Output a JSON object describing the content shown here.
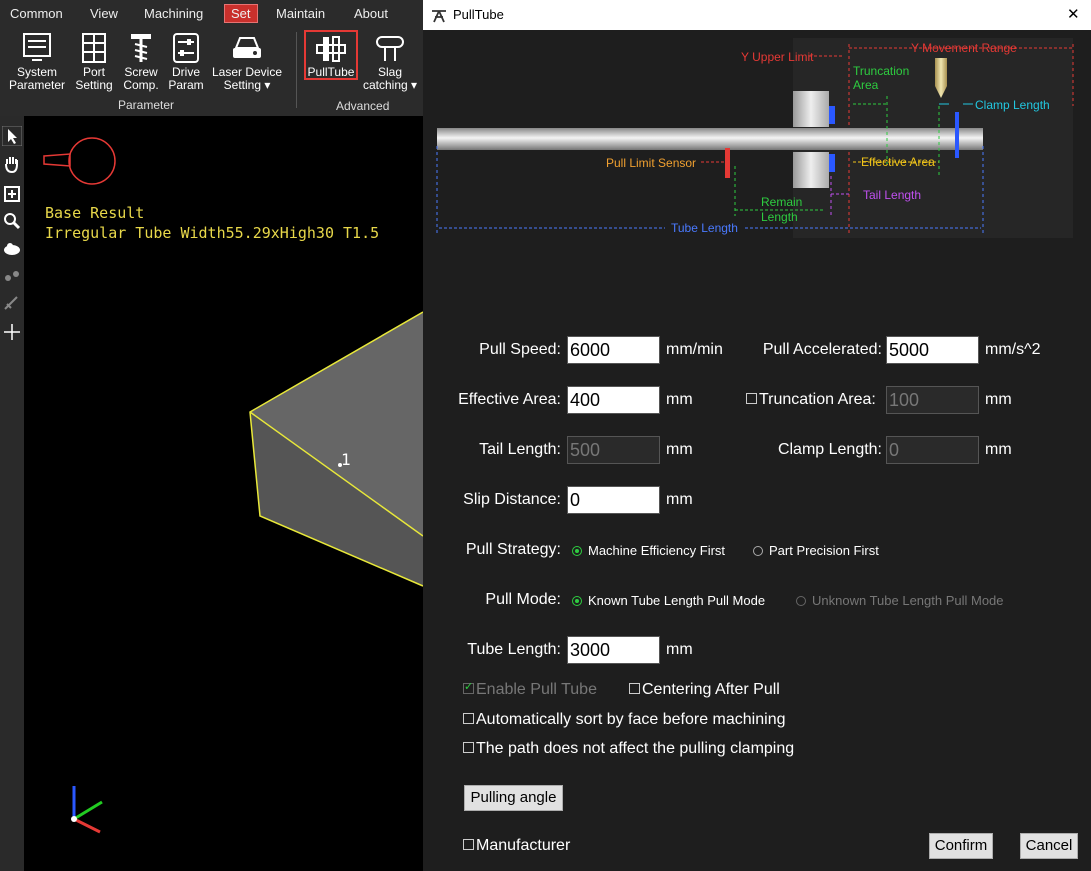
{
  "menubar": {
    "items": [
      "Common",
      "View",
      "Machining",
      "Set",
      "Maintain",
      "About"
    ],
    "active": "Set"
  },
  "ribbon": {
    "buttons": [
      {
        "label1": "System",
        "label2": "Parameter"
      },
      {
        "label1": "Port",
        "label2": "Setting"
      },
      {
        "label1": "Screw",
        "label2": "Comp."
      },
      {
        "label1": "Drive",
        "label2": "Param"
      },
      {
        "label1": "Laser Device",
        "label2": "Setting ▾"
      },
      {
        "label1": "PullTube",
        "label2": ""
      },
      {
        "label1": "Slag",
        "label2": "catching ▾"
      }
    ],
    "groups": {
      "parameter": "Parameter",
      "advanced": "Advanced"
    }
  },
  "viewport": {
    "line1": "Base Result",
    "line2": "Irregular Tube Width55.29xHigh30 T1.5",
    "marker": "1"
  },
  "dialog": {
    "title": "PullTube",
    "close_glyph": "✕",
    "diagram": {
      "y_upper_limit": "Y Upper Limit",
      "y_movement_range": "Y Movement Range",
      "truncation_area_1": "Truncation",
      "truncation_area_2": "Area",
      "clamp_length": "Clamp Length",
      "pull_limit_sensor": "Pull Limit Sensor",
      "effective_area": "Effective Area",
      "tail_length": "Tail Length",
      "remain_length_1": "Remain",
      "remain_length_2": "Length",
      "tube_length": "Tube Length"
    },
    "fields": {
      "pull_speed": {
        "label": "Pull Speed:",
        "value": "6000",
        "unit": "mm/min"
      },
      "pull_accelerated": {
        "label": "Pull Accelerated:",
        "value": "5000",
        "unit": "mm/s^2"
      },
      "effective_area": {
        "label": "Effective Area:",
        "value": "400",
        "unit": "mm"
      },
      "truncation_area": {
        "label": "Truncation Area:",
        "value": "100",
        "unit": "mm"
      },
      "tail_length": {
        "label": "Tail Length:",
        "value": "500",
        "unit": "mm"
      },
      "clamp_length": {
        "label": "Clamp Length:",
        "value": "0",
        "unit": "mm"
      },
      "slip_distance": {
        "label": "Slip Distance:",
        "value": "0",
        "unit": "mm"
      },
      "tube_length": {
        "label": "Tube Length:",
        "value": "3000",
        "unit": "mm"
      }
    },
    "pull_strategy": {
      "label": "Pull Strategy:",
      "options": [
        "Machine Efficiency First",
        "Part Precision First"
      ],
      "selected": "Machine Efficiency First"
    },
    "pull_mode": {
      "label": "Pull Mode:",
      "options": [
        "Known Tube Length Pull Mode",
        "Unknown Tube Length Pull Mode"
      ],
      "selected": "Known Tube Length Pull Mode"
    },
    "checks": {
      "enable_pull_tube": "Enable Pull Tube",
      "centering_after_pull": "Centering After Pull",
      "auto_sort": "Automatically sort by face before machining",
      "path_not_affect": "The path does not affect the pulling clamping",
      "manufacturer": "Manufacturer"
    },
    "buttons": {
      "pulling_angle": "Pulling angle",
      "confirm": "Confirm",
      "cancel": "Cancel"
    }
  },
  "colors": {
    "accent_red": "#e53935",
    "radio_green": "#2ecc40",
    "dialog_bg": "#1e1e1e"
  }
}
